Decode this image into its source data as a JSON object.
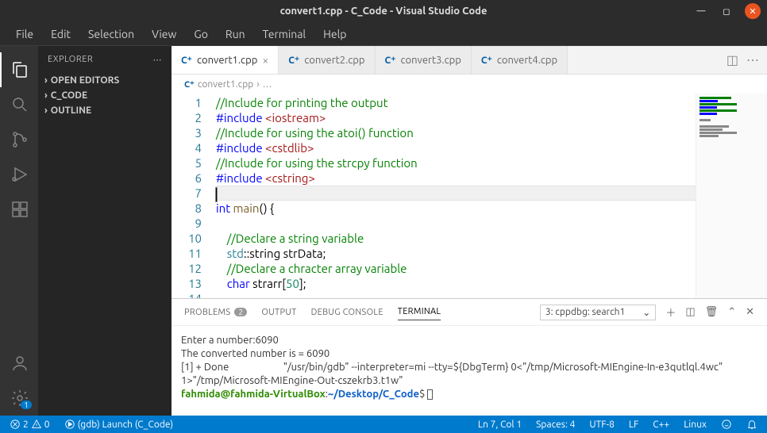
{
  "window": {
    "title": "convert1.cpp - C_Code - Visual Studio Code"
  },
  "menu": {
    "items": [
      "File",
      "Edit",
      "Selection",
      "View",
      "Go",
      "Run",
      "Terminal",
      "Help"
    ]
  },
  "sidebar": {
    "title": "EXPLORER",
    "sections": [
      "OPEN EDITORS",
      "C_CODE",
      "OUTLINE"
    ]
  },
  "tabs": {
    "items": [
      {
        "label": "convert1.cpp",
        "active": true
      },
      {
        "label": "convert2.cpp",
        "active": false
      },
      {
        "label": "convert3.cpp",
        "active": false
      },
      {
        "label": "convert4.cpp",
        "active": false
      }
    ]
  },
  "breadcrumb": {
    "file": "convert1.cpp"
  },
  "code": {
    "lines": [
      {
        "n": 1,
        "segs": [
          {
            "t": "//Include for printing the output",
            "c": "c-comment"
          }
        ]
      },
      {
        "n": 2,
        "segs": [
          {
            "t": "#include ",
            "c": "c-keyword"
          },
          {
            "t": "<iostream>",
            "c": "c-string"
          }
        ]
      },
      {
        "n": 3,
        "segs": [
          {
            "t": "//Include for using the atoi() function",
            "c": "c-comment"
          }
        ]
      },
      {
        "n": 4,
        "segs": [
          {
            "t": "#include ",
            "c": "c-keyword"
          },
          {
            "t": "<cstdlib>",
            "c": "c-string"
          }
        ]
      },
      {
        "n": 5,
        "segs": [
          {
            "t": "//Include for using the strcpy function",
            "c": "c-comment"
          }
        ]
      },
      {
        "n": 6,
        "segs": [
          {
            "t": "#include ",
            "c": "c-keyword"
          },
          {
            "t": "<cstring>",
            "c": "c-string"
          }
        ]
      },
      {
        "n": 7,
        "segs": [],
        "current": true
      },
      {
        "n": 8,
        "segs": [
          {
            "t": "int",
            "c": "c-type"
          },
          {
            "t": " ",
            "c": ""
          },
          {
            "t": "main",
            "c": "c-func"
          },
          {
            "t": "() {",
            "c": ""
          }
        ]
      },
      {
        "n": 9,
        "segs": []
      },
      {
        "n": 10,
        "segs": [
          {
            "t": "    ",
            "c": ""
          },
          {
            "t": "//Declare a string variable",
            "c": "c-comment"
          }
        ]
      },
      {
        "n": 11,
        "segs": [
          {
            "t": "    ",
            "c": ""
          },
          {
            "t": "std",
            "c": "c-ns"
          },
          {
            "t": "::string strData;",
            "c": ""
          }
        ]
      },
      {
        "n": 12,
        "segs": [
          {
            "t": "    ",
            "c": ""
          },
          {
            "t": "//Declare a chracter array variable",
            "c": "c-comment"
          }
        ]
      },
      {
        "n": 13,
        "segs": [
          {
            "t": "    ",
            "c": ""
          },
          {
            "t": "char",
            "c": "c-type"
          },
          {
            "t": " strarr[",
            "c": ""
          },
          {
            "t": "50",
            "c": "c-number"
          },
          {
            "t": "];",
            "c": ""
          }
        ]
      },
      {
        "n": 14,
        "segs": []
      }
    ]
  },
  "panel": {
    "tabs": {
      "problems": "PROBLEMS",
      "problems_count": "2",
      "output": "OUTPUT",
      "debug": "DEBUG CONSOLE",
      "terminal": "TERMINAL"
    },
    "terminal_select": "3: cppdbg: search1",
    "terminal_lines": [
      "Enter a number:6090",
      "The converted number is = 6090",
      "[1] + Done                       \"/usr/bin/gdb\" --interpreter=mi --tty=${DbgTerm} 0<\"/tmp/Microsoft-MIEngine-In-e3qutlql.4wc\" 1>\"/tmp/Microsoft-MIEngine-Out-cszekrb3.t1w\""
    ],
    "prompt_user": "fahmida@fahmida-VirtualBox",
    "prompt_path": "~/Desktop/C_Code",
    "prompt_sep": ":",
    "prompt_end": "$"
  },
  "status": {
    "errors": "2",
    "warnings": "0",
    "launch": "(gdb) Launch (C_Code)",
    "lncol": "Ln 7, Col 1",
    "spaces": "Spaces: 4",
    "encoding": "UTF-8",
    "eol": "LF",
    "lang": "C++",
    "os": "Linux"
  }
}
